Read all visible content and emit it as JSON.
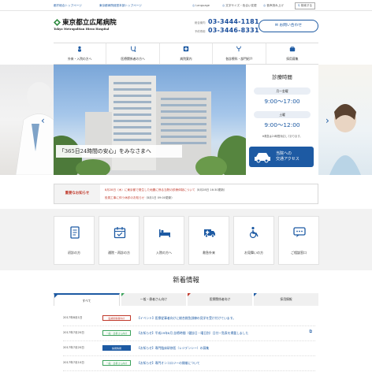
{
  "topbar": {
    "link1": "都庁総合トップページ",
    "link2": "東京都病院経営本部トップページ",
    "language": "Language",
    "font": "文字サイズ・色合い変更",
    "voice": "音声読み上げ",
    "search": "検索する"
  },
  "brand": {
    "name_jp": "東京都立広尾病院",
    "name_en": "Tokyo Metropolitan Hiroo Hospital",
    "color": "#1d5aa3"
  },
  "phones": [
    {
      "label": "総合案内",
      "number": "03-3444-1181"
    },
    {
      "label": "予約専用",
      "number": "03-3446-8331"
    }
  ],
  "contact_label": "お問い合わせ",
  "nav": [
    {
      "label": "外来・入院の方へ",
      "icon": "person-icon"
    },
    {
      "label": "医療関係者の方へ",
      "icon": "stethoscope-icon"
    },
    {
      "label": "病院案内",
      "icon": "hospital-cross-icon"
    },
    {
      "label": "各診療科・部門紹介",
      "icon": "department-icon"
    },
    {
      "label": "採用募集",
      "icon": "recruit-icon"
    }
  ],
  "hero": {
    "caption": "「365日24時間の安心」をみなさまへ"
  },
  "hours": {
    "title": "診療時間",
    "weekday_label": "月～金曜",
    "weekday_time": "9:00～17:00",
    "saturday_label": "土曜",
    "saturday_time": "9:00～12:00",
    "note": "※救急は24時間対応しております。",
    "access_label_1": "当院への",
    "access_label_2": "交通アクセス"
  },
  "notice": {
    "label": "重要なお知らせ",
    "items": [
      {
        "text": "8月28日（木）に東京都で発生した地震に係る当院の診療体制について",
        "date": "（8月28日 16:30更新）"
      },
      {
        "text": "役員工事に伴う休診のお知らせ",
        "date": "（8月1日 09:00更新）"
      }
    ]
  },
  "cards": [
    {
      "label": "初診の方",
      "icon": "document-icon"
    },
    {
      "label": "通院・再診の方",
      "icon": "calendar-icon"
    },
    {
      "label": "入院の方へ",
      "icon": "bed-icon"
    },
    {
      "label": "救急外来",
      "icon": "ambulance-icon"
    },
    {
      "label": "お見舞いの方",
      "icon": "wheelchair-icon"
    },
    {
      "label": "ご相談窓口",
      "icon": "consultation-icon"
    }
  ],
  "news": {
    "title": "新着情報",
    "tabs": [
      {
        "label": "すべて",
        "color": "#1d5aa3"
      },
      {
        "label": "一般・患者さん向け",
        "color": "#3aa15a"
      },
      {
        "label": "医療関係者向け",
        "color": "#c0392b"
      },
      {
        "label": "採用情報",
        "color": "#1d5aa3"
      }
    ],
    "items": [
      {
        "date": "2017年8月1日",
        "category": "医療関係者向け",
        "color": "#c0392b",
        "text": "【イベント】医療従事者向けに総合救急訓練の見学を受け付けています。"
      },
      {
        "date": "2017年7月20日",
        "category": "一般・患者さん向け",
        "color": "#3aa15a",
        "text": "【お知らせ】平成29年8月 診療時間（健診日・曜日別）日付一覧表を掲載しました"
      },
      {
        "date": "2017年7月20日",
        "category": "採用情報",
        "color": "#1d5aa3",
        "text": "【お知らせ】専門臨床研修医（レジデンシー）の募集"
      },
      {
        "date": "2017年7月10日",
        "category": "一般・患者さん向け",
        "color": "#3aa15a",
        "text": "【お知らせ】専門オンコロジーの開催について"
      }
    ]
  }
}
